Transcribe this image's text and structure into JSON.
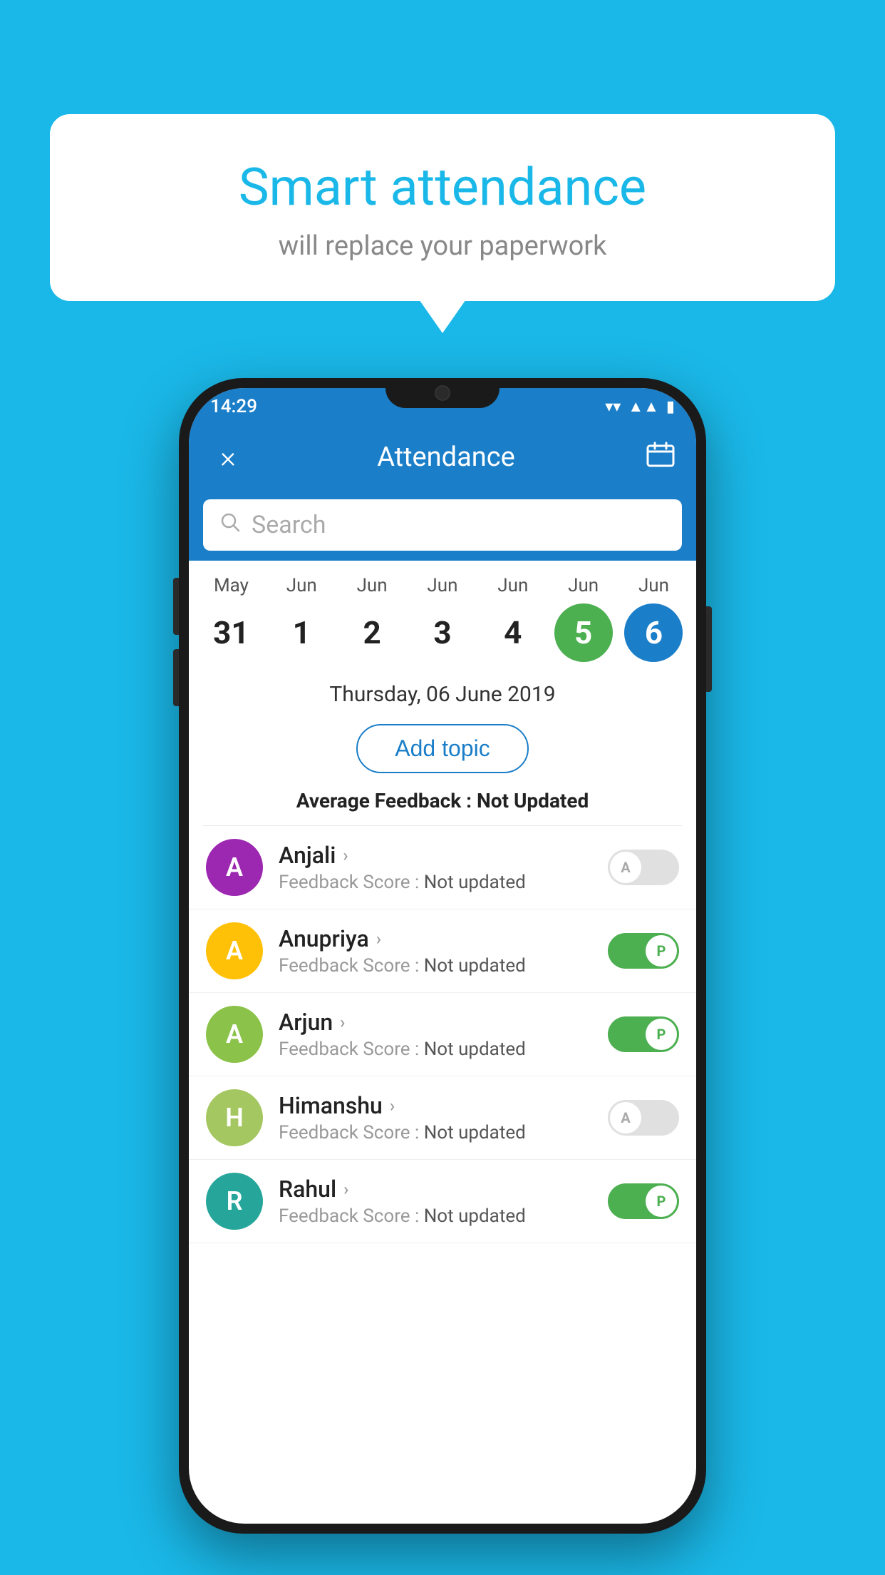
{
  "background_color": "#1ab8e8",
  "speech_bubble": {
    "title": "Smart attendance",
    "subtitle": "will replace your paperwork"
  },
  "status_bar": {
    "time": "14:29",
    "wifi_icon": "▾",
    "signal_icon": "◂",
    "battery_icon": "▮"
  },
  "header": {
    "title": "Attendance",
    "close_label": "×",
    "calendar_icon": "📅"
  },
  "search": {
    "placeholder": "Search"
  },
  "calendar": {
    "days": [
      {
        "month": "May",
        "date": "31",
        "state": "normal"
      },
      {
        "month": "Jun",
        "date": "1",
        "state": "normal"
      },
      {
        "month": "Jun",
        "date": "2",
        "state": "normal"
      },
      {
        "month": "Jun",
        "date": "3",
        "state": "normal"
      },
      {
        "month": "Jun",
        "date": "4",
        "state": "normal"
      },
      {
        "month": "Jun",
        "date": "5",
        "state": "today"
      },
      {
        "month": "Jun",
        "date": "6",
        "state": "selected"
      }
    ]
  },
  "selected_date_label": "Thursday, 06 June 2019",
  "add_topic_button": "Add topic",
  "average_feedback": {
    "label": "Average Feedback : ",
    "value": "Not Updated"
  },
  "students": [
    {
      "name": "Anjali",
      "avatar_letter": "A",
      "avatar_color": "#9c27b0",
      "feedback_label": "Feedback Score : ",
      "feedback_value": "Not updated",
      "toggle_state": "off",
      "toggle_label": "A"
    },
    {
      "name": "Anupriya",
      "avatar_letter": "A",
      "avatar_color": "#ffc107",
      "feedback_label": "Feedback Score : ",
      "feedback_value": "Not updated",
      "toggle_state": "on",
      "toggle_label": "P"
    },
    {
      "name": "Arjun",
      "avatar_letter": "A",
      "avatar_color": "#8bc34a",
      "feedback_label": "Feedback Score : ",
      "feedback_value": "Not updated",
      "toggle_state": "on",
      "toggle_label": "P"
    },
    {
      "name": "Himanshu",
      "avatar_letter": "H",
      "avatar_color": "#a5c761",
      "feedback_label": "Feedback Score : ",
      "feedback_value": "Not updated",
      "toggle_state": "off",
      "toggle_label": "A"
    },
    {
      "name": "Rahul",
      "avatar_letter": "R",
      "avatar_color": "#26a69a",
      "feedback_label": "Feedback Score : ",
      "feedback_value": "Not updated",
      "toggle_state": "on",
      "toggle_label": "P"
    }
  ]
}
